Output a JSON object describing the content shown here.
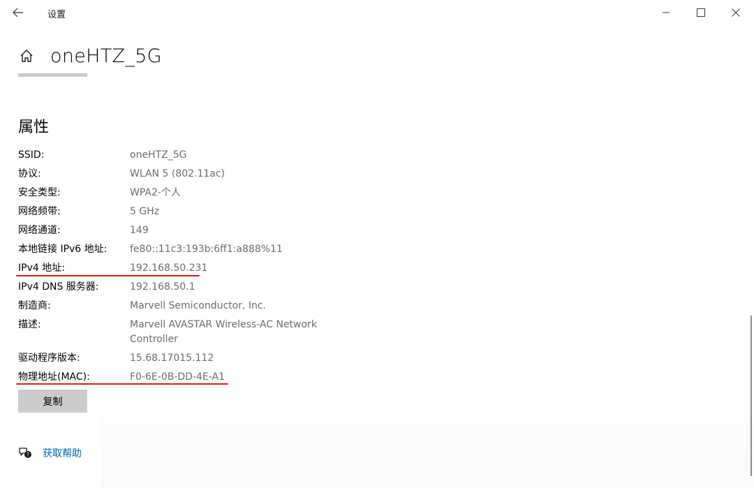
{
  "window": {
    "title": "设置",
    "controls": {
      "minimize": "minimize-icon",
      "maximize": "maximize-icon",
      "close": "close-icon"
    }
  },
  "header": {
    "title": "oneHTZ_5G",
    "home_icon": "home-icon"
  },
  "properties": {
    "section_title": "属性",
    "items": [
      {
        "label": "SSID:",
        "value": "oneHTZ_5G"
      },
      {
        "label": "协议:",
        "value": "WLAN 5 (802.11ac)"
      },
      {
        "label": "安全类型:",
        "value": "WPA2-个人"
      },
      {
        "label": "网络频带:",
        "value": "5 GHz"
      },
      {
        "label": "网络通道:",
        "value": "149"
      },
      {
        "label": "本地链接 IPv6 地址:",
        "value": "fe80::11c3:193b:6ff1:a888%11"
      },
      {
        "label": "IPv4 地址:",
        "value": "192.168.50.231"
      },
      {
        "label": "IPv4 DNS 服务器:",
        "value": "192.168.50.1"
      },
      {
        "label": "制造商:",
        "value": "Marvell Semiconductor, Inc."
      },
      {
        "label": "描述:",
        "value": "Marvell AVASTAR Wireless-AC Network Controller"
      },
      {
        "label": "驱动程序版本:",
        "value": "15.68.17015.112"
      },
      {
        "label": "物理地址(MAC):",
        "value": "F0-6E-0B-DD-4E-A1"
      }
    ],
    "copy_label": "复制"
  },
  "help": {
    "label": "获取帮助",
    "icon": "help-chat-icon"
  },
  "colors": {
    "accent": "#0063b1",
    "annotation": "#e0181c",
    "value_text": "#6b6b6b",
    "button_bg": "#cccccc"
  }
}
